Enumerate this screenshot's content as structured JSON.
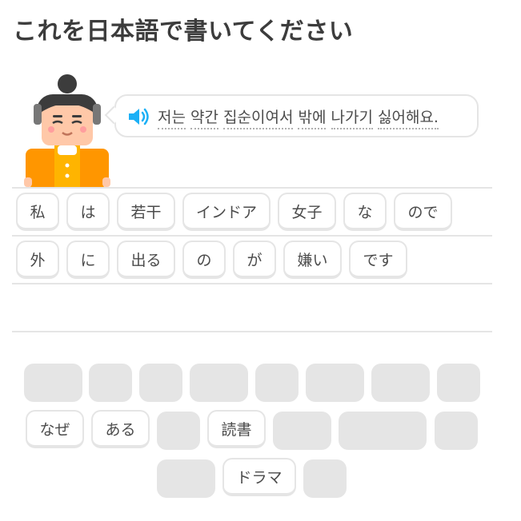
{
  "header": {
    "title": "これを日本語で書いてください"
  },
  "prompt": {
    "words": [
      "저는",
      "약간",
      "집순이여서",
      "밖에",
      "나가기",
      "싫어해요."
    ]
  },
  "answer": {
    "row1": [
      "私",
      "は",
      "若干",
      "インドア",
      "女子",
      "な",
      "ので"
    ],
    "row2": [
      "外",
      "に",
      "出る",
      "の",
      "が",
      "嫌い",
      "です"
    ]
  },
  "bank": {
    "row2_tiles": [
      "なぜ",
      "ある",
      "読書"
    ],
    "row3_tiles": [
      "ドラマ"
    ]
  },
  "colors": {
    "speaker": "#1cb0f6",
    "tile_border": "#e5e5e5",
    "slot": "#e5e5e5",
    "shirt": "#ff9600",
    "hair": "#3c3c3c"
  }
}
